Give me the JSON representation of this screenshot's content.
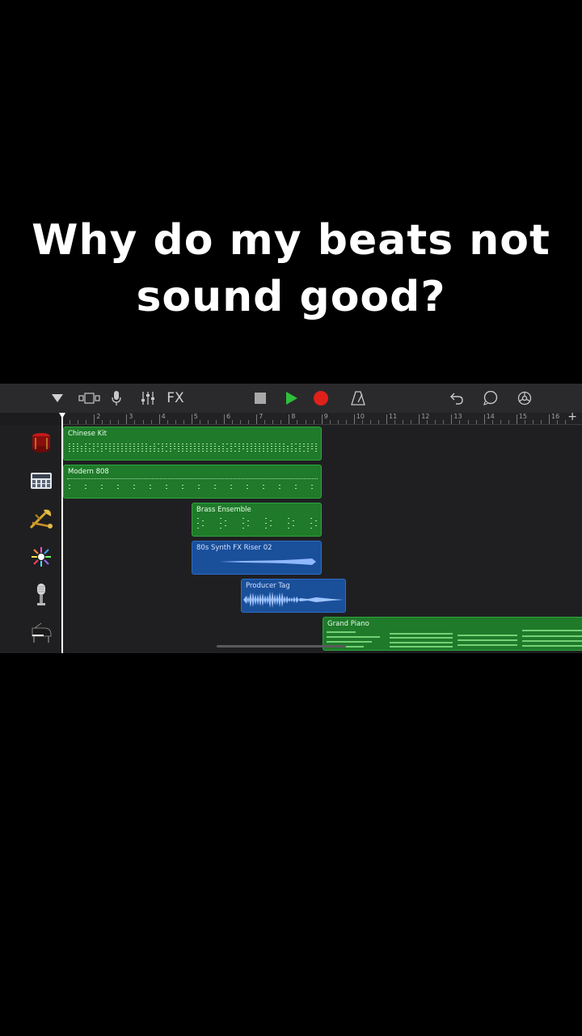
{
  "caption": {
    "line1": "Why do my beats not",
    "line2": "sound good?"
  },
  "toolbar": {
    "icons": [
      "track-view-toggle-icon",
      "browser-icon",
      "mic-icon",
      "mixer-icon",
      "stop-icon",
      "play-icon",
      "record-icon",
      "metronome-icon",
      "undo-icon",
      "loop-icon",
      "settings-icon"
    ],
    "fx_label": "FX"
  },
  "ruler": {
    "bars": [
      "2",
      "3",
      "4",
      "5",
      "6",
      "7",
      "8",
      "9",
      "10",
      "11",
      "12",
      "13",
      "14",
      "15",
      "16"
    ],
    "add_label": "+"
  },
  "tracks": [
    {
      "instrument": "drum-kit-icon",
      "region": {
        "name": "Chinese Kit",
        "kind": "midi"
      }
    },
    {
      "instrument": "drum-machine-icon",
      "region": {
        "name": "Modern 808",
        "kind": "midi"
      }
    },
    {
      "instrument": "brass-icon",
      "region": {
        "name": "Brass Ensemble",
        "kind": "midi"
      }
    },
    {
      "instrument": "synth-fx-icon",
      "region": {
        "name": "80s Synth FX Riser 02",
        "kind": "audio"
      }
    },
    {
      "instrument": "microphone-icon",
      "region": {
        "name": "Producer Tag",
        "kind": "audio"
      }
    },
    {
      "instrument": "grand-piano-icon",
      "region": {
        "name": "Grand Piano",
        "kind": "midi"
      }
    }
  ],
  "colors": {
    "midi_region": "#1f7a2a",
    "audio_region": "#1a4f9a",
    "record": "#e0201b",
    "play": "#2fbf3a"
  }
}
